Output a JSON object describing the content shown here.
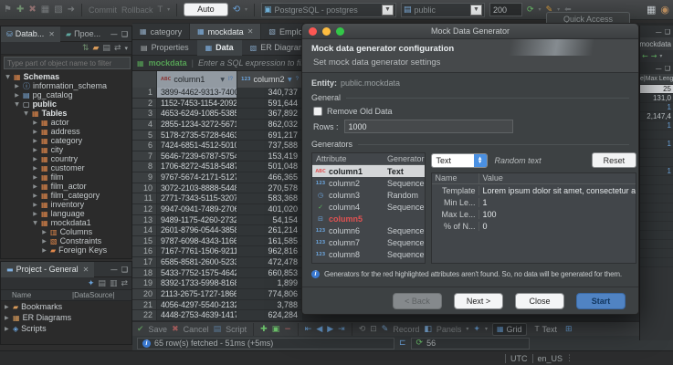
{
  "toolbar": {
    "commit": "Commit",
    "rollback": "Rollback",
    "auto": "Auto",
    "connection": "PostgreSQL - postgres",
    "schema": "public",
    "fetch_size": "200",
    "quick_access": "Quick Access"
  },
  "icons": {
    "tx_mode": "T",
    "abc_type": "ABC",
    "numeric_type": "123",
    "filter_sort_1": "I?",
    "filter_sort_2": "?",
    "info": "i"
  },
  "type_icons": {
    "abc": "ABC",
    "123": "123",
    "clock": "◷",
    "check": "✓",
    "box": "⊟"
  },
  "sidebar": {
    "tabs": [
      {
        "label": "Datab..."
      },
      {
        "label": "Прое..."
      }
    ],
    "filter_placeholder": "Type part of object name to filter",
    "tree": [
      {
        "a": "v",
        "i": "db",
        "t": "Schemas",
        "d": 0,
        "b": true
      },
      {
        "a": "r",
        "i": "info",
        "t": "information_schema",
        "d": 1,
        "b": false
      },
      {
        "a": "r",
        "i": "cat",
        "t": "pg_catalog",
        "d": 1,
        "b": false
      },
      {
        "a": "v",
        "i": "page",
        "t": "public",
        "d": 1,
        "b": true
      },
      {
        "a": "v",
        "i": "tables",
        "t": "Tables",
        "d": 2,
        "b": true
      },
      {
        "a": "r",
        "i": "table",
        "t": "actor",
        "d": 3,
        "b": false
      },
      {
        "a": "r",
        "i": "table",
        "t": "address",
        "d": 3,
        "b": false
      },
      {
        "a": "r",
        "i": "table",
        "t": "category",
        "d": 3,
        "b": false
      },
      {
        "a": "r",
        "i": "table",
        "t": "city",
        "d": 3,
        "b": false
      },
      {
        "a": "r",
        "i": "table",
        "t": "country",
        "d": 3,
        "b": false
      },
      {
        "a": "r",
        "i": "table",
        "t": "customer",
        "d": 3,
        "b": false
      },
      {
        "a": "r",
        "i": "table",
        "t": "film",
        "d": 3,
        "b": false
      },
      {
        "a": "r",
        "i": "table",
        "t": "film_actor",
        "d": 3,
        "b": false
      },
      {
        "a": "r",
        "i": "table",
        "t": "film_category",
        "d": 3,
        "b": false
      },
      {
        "a": "r",
        "i": "table",
        "t": "inventory",
        "d": 3,
        "b": false
      },
      {
        "a": "r",
        "i": "table",
        "t": "language",
        "d": 3,
        "b": false
      },
      {
        "a": "v",
        "i": "table",
        "t": "mockdata1",
        "d": 3,
        "b": false
      },
      {
        "a": "r",
        "i": "cols",
        "t": "Columns",
        "d": 4,
        "b": false
      },
      {
        "a": "r",
        "i": "constr",
        "t": "Constraints",
        "d": 4,
        "b": false
      },
      {
        "a": "r",
        "i": "folder",
        "t": "Foreign Keys",
        "d": 4,
        "b": false
      }
    ]
  },
  "project_panel": {
    "title": "Project - General",
    "name_col": "Name",
    "source_col": "|DataSource|",
    "items": [
      "Bookmarks",
      "ER Diagrams",
      "Scripts"
    ]
  },
  "editor": {
    "tabs": [
      "category",
      "mockdata",
      "Employee"
    ],
    "subtabs": [
      "Properties",
      "Data",
      "ER Diagram"
    ],
    "filter_table": "mockdata",
    "filter_placeholder": "Enter a SQL expression to filter resu",
    "grid": {
      "columns": [
        "column1",
        "column2"
      ],
      "rows": [
        [
          "3899-4462-9313-7400",
          "340,737"
        ],
        [
          "1152-7453-1154-2092",
          "591,644"
        ],
        [
          "4653-6249-1085-5385",
          "367,892"
        ],
        [
          "2855-1234-3272-5671",
          "862,032"
        ],
        [
          "5178-2735-5728-6463",
          "691,217"
        ],
        [
          "7424-6851-4512-5010",
          "737,588"
        ],
        [
          "5646-7239-6787-5754",
          "153,419"
        ],
        [
          "1706-8272-4518-5487",
          "501,048"
        ],
        [
          "9767-5674-2171-5127",
          "466,365"
        ],
        [
          "3072-2103-8888-5448",
          "270,578"
        ],
        [
          "2771-7343-5115-3207",
          "583,368"
        ],
        [
          "9947-0941-7489-2706",
          "401,020"
        ],
        [
          "9489-1175-4260-2732",
          "54,154"
        ],
        [
          "2601-8796-0544-3858",
          "261,214"
        ],
        [
          "9787-6098-4343-1166",
          "161,585"
        ],
        [
          "7167-7761-1506-9211",
          "962,816"
        ],
        [
          "6585-8581-2600-5233",
          "472,478"
        ],
        [
          "5433-7752-1575-4642",
          "660,853"
        ],
        [
          "8392-1733-5998-8168",
          "1,899"
        ],
        [
          "2113-2675-1727-1866",
          "774,806"
        ],
        [
          "4056-4297-5540-2132",
          "3,788"
        ],
        [
          "4448-2753-4639-1417",
          "624,284"
        ]
      ]
    },
    "footer": {
      "save": "Save",
      "cancel": "Cancel",
      "script": "Script",
      "record": "Record",
      "panels": "Panels",
      "grid": "Grid",
      "text": "Text"
    },
    "status": "65 row(s) fetched - 51ms (+5ms)",
    "refresh_value": "56"
  },
  "dialog": {
    "title": "Mock Data Generator",
    "heading": "Mock data generator configuration",
    "subheading": "Set mock data generator settings",
    "entity_label": "Entity:",
    "entity_value": "public.mockdata",
    "general_label": "General",
    "remove_old_data_label": "Remove Old Data",
    "rows_label": "Rows :",
    "rows_value": "1000",
    "generators_label": "Generators",
    "attr_col": "Attribute",
    "gen_col": "Generator",
    "attributes": [
      {
        "name": "column1",
        "generator": "Text",
        "icon": "abc",
        "selected": true,
        "red": false
      },
      {
        "name": "column2",
        "generator": "Sequence",
        "icon": "123",
        "selected": false,
        "red": false
      },
      {
        "name": "column3",
        "generator": "Random",
        "icon": "clock",
        "selected": false,
        "red": false
      },
      {
        "name": "column4",
        "generator": "Sequence",
        "icon": "check",
        "selected": false,
        "red": false
      },
      {
        "name": "column5",
        "generator": "",
        "icon": "box",
        "selected": false,
        "red": true
      },
      {
        "name": "column6",
        "generator": "Sequence",
        "icon": "123",
        "selected": false,
        "red": false
      },
      {
        "name": "column7",
        "generator": "Sequence",
        "icon": "123",
        "selected": false,
        "red": false
      },
      {
        "name": "column8",
        "generator": "Sequence",
        "icon": "123",
        "selected": false,
        "red": false
      }
    ],
    "generator_combo": "Text",
    "generator_desc": "Random text",
    "reset_label": "Reset",
    "props_name_col": "Name",
    "props_value_col": "Value",
    "props": [
      [
        "Template",
        "Lorem ipsum dolor sit amet, consectetur a"
      ],
      [
        "Min Le...",
        "1"
      ],
      [
        "Max Le...",
        "100"
      ],
      [
        "% of N...",
        "0"
      ]
    ],
    "info": "Generators for the red highlighted attributes aren't found. So, no data will be generated for them.",
    "back_label": "< Back",
    "next_label": "Next >",
    "close_label": "Close",
    "start_label": "Start"
  },
  "right_panel": {
    "tab": "mockdata",
    "header": "e|Max Leng",
    "rows": [
      "25",
      "131,0",
      "1",
      "2,147,4",
      "1",
      "",
      "1",
      "",
      "",
      "1",
      "",
      "",
      "",
      "",
      "",
      "",
      "",
      "",
      "",
      ""
    ]
  },
  "statusbar": {
    "timezone": "UTC",
    "locale": "en_US"
  }
}
